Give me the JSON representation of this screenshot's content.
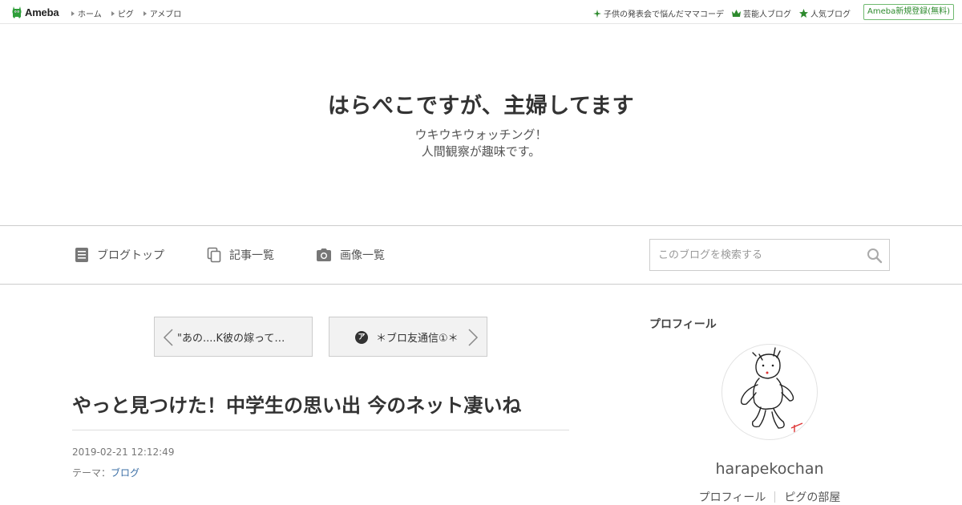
{
  "topbar": {
    "logo_text": "Ameba",
    "nav": [
      "ホーム",
      "ピグ",
      "アメブロ"
    ],
    "right_links": [
      {
        "icon": "sparkle-icon",
        "label": "子供の発表会で悩んだママコーデ"
      },
      {
        "icon": "crown-icon",
        "label": "芸能人ブログ"
      },
      {
        "icon": "star-icon",
        "label": "人気ブログ"
      }
    ],
    "register_label": "Ameba新規登録(無料)"
  },
  "header": {
    "title": "はらぺこですが、主婦してます",
    "desc_line1": "ウキウキウォッチング！",
    "desc_line2": "人間観察が趣味です。"
  },
  "nav": {
    "blog_top": "ブログトップ",
    "entry_list": "記事一覧",
    "image_list": "画像一覧",
    "search_placeholder": "このブログを検索する"
  },
  "pager": {
    "prev_label": "\"あの....K彼の嫁って…",
    "next_label": "＊ブロ友通信①＊",
    "next_badge": "ア"
  },
  "article": {
    "title": "やっと見つけた！中学生の思い出 今のネット凄いね",
    "date": "2019-02-21 12:12:49",
    "theme_prefix": "テーマ：",
    "theme_link": "ブログ"
  },
  "sidebar": {
    "heading": "プロフィール",
    "username": "harapekochan",
    "links": [
      "プロフィール",
      "ピグの部屋"
    ]
  },
  "colors": {
    "accent_green": "#2d8a2d",
    "link_blue": "#3a6ea5"
  }
}
